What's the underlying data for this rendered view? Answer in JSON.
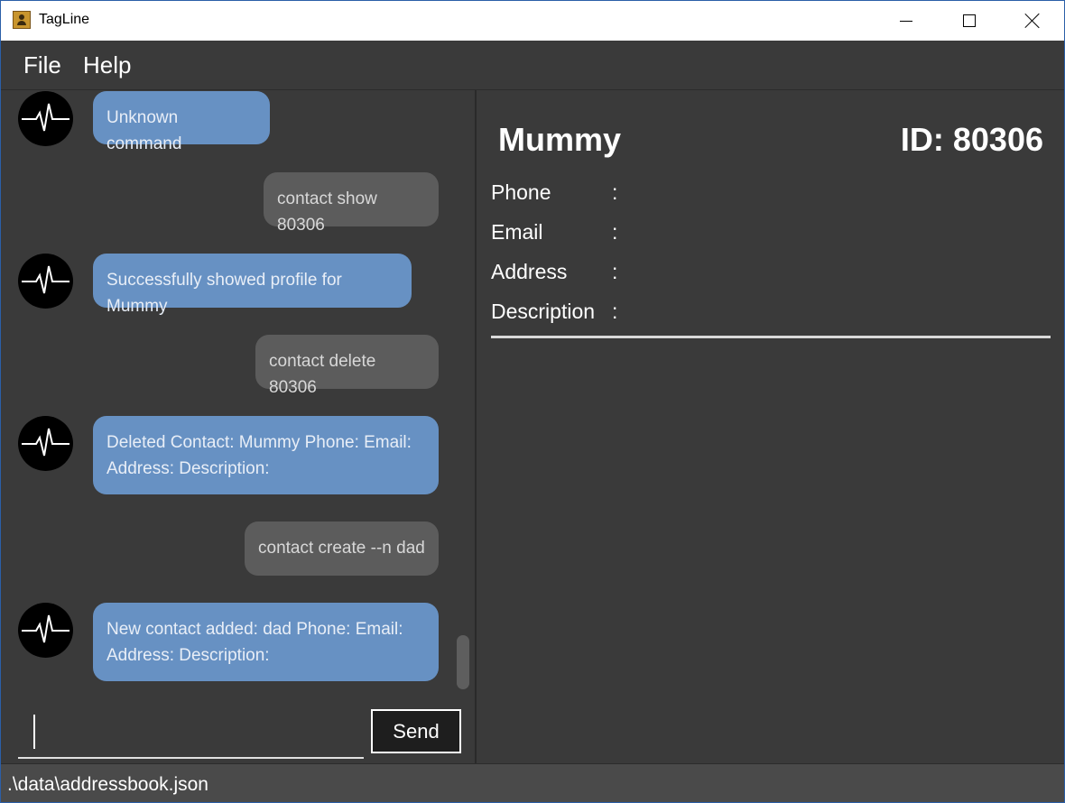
{
  "window": {
    "title": "TagLine",
    "minimize_icon": "minimize-icon",
    "maximize_icon": "maximize-icon",
    "close_icon": "close-icon"
  },
  "menu": {
    "file": "File",
    "help": "Help"
  },
  "chat": {
    "messages": [
      {
        "sender": "bot",
        "text": "Unknown command"
      },
      {
        "sender": "user",
        "text": "contact show 80306"
      },
      {
        "sender": "bot",
        "text": "Successfully showed profile for Mummy"
      },
      {
        "sender": "user",
        "text": "contact delete 80306"
      },
      {
        "sender": "bot",
        "text": "Deleted Contact: Mummy Phone:  Email:  Address:  Description:"
      },
      {
        "sender": "user",
        "text": "contact create --n dad"
      },
      {
        "sender": "bot",
        "text": "New contact added: dad Phone:  Email:  Address:  Description:"
      }
    ],
    "input_value": "",
    "send_label": "Send",
    "colors": {
      "bot_bubble": "#6791c3",
      "user_bubble": "#5c5c5c"
    }
  },
  "contact": {
    "name": "Mummy",
    "id_label": "ID: 80306",
    "fields": [
      {
        "label": "Phone",
        "sep": ":",
        "value": ""
      },
      {
        "label": "Email",
        "sep": ":",
        "value": ""
      },
      {
        "label": "Address",
        "sep": ":",
        "value": ""
      },
      {
        "label": "Description",
        "sep": ":",
        "value": ""
      }
    ]
  },
  "status": {
    "path": ".\\data\\addressbook.json"
  }
}
